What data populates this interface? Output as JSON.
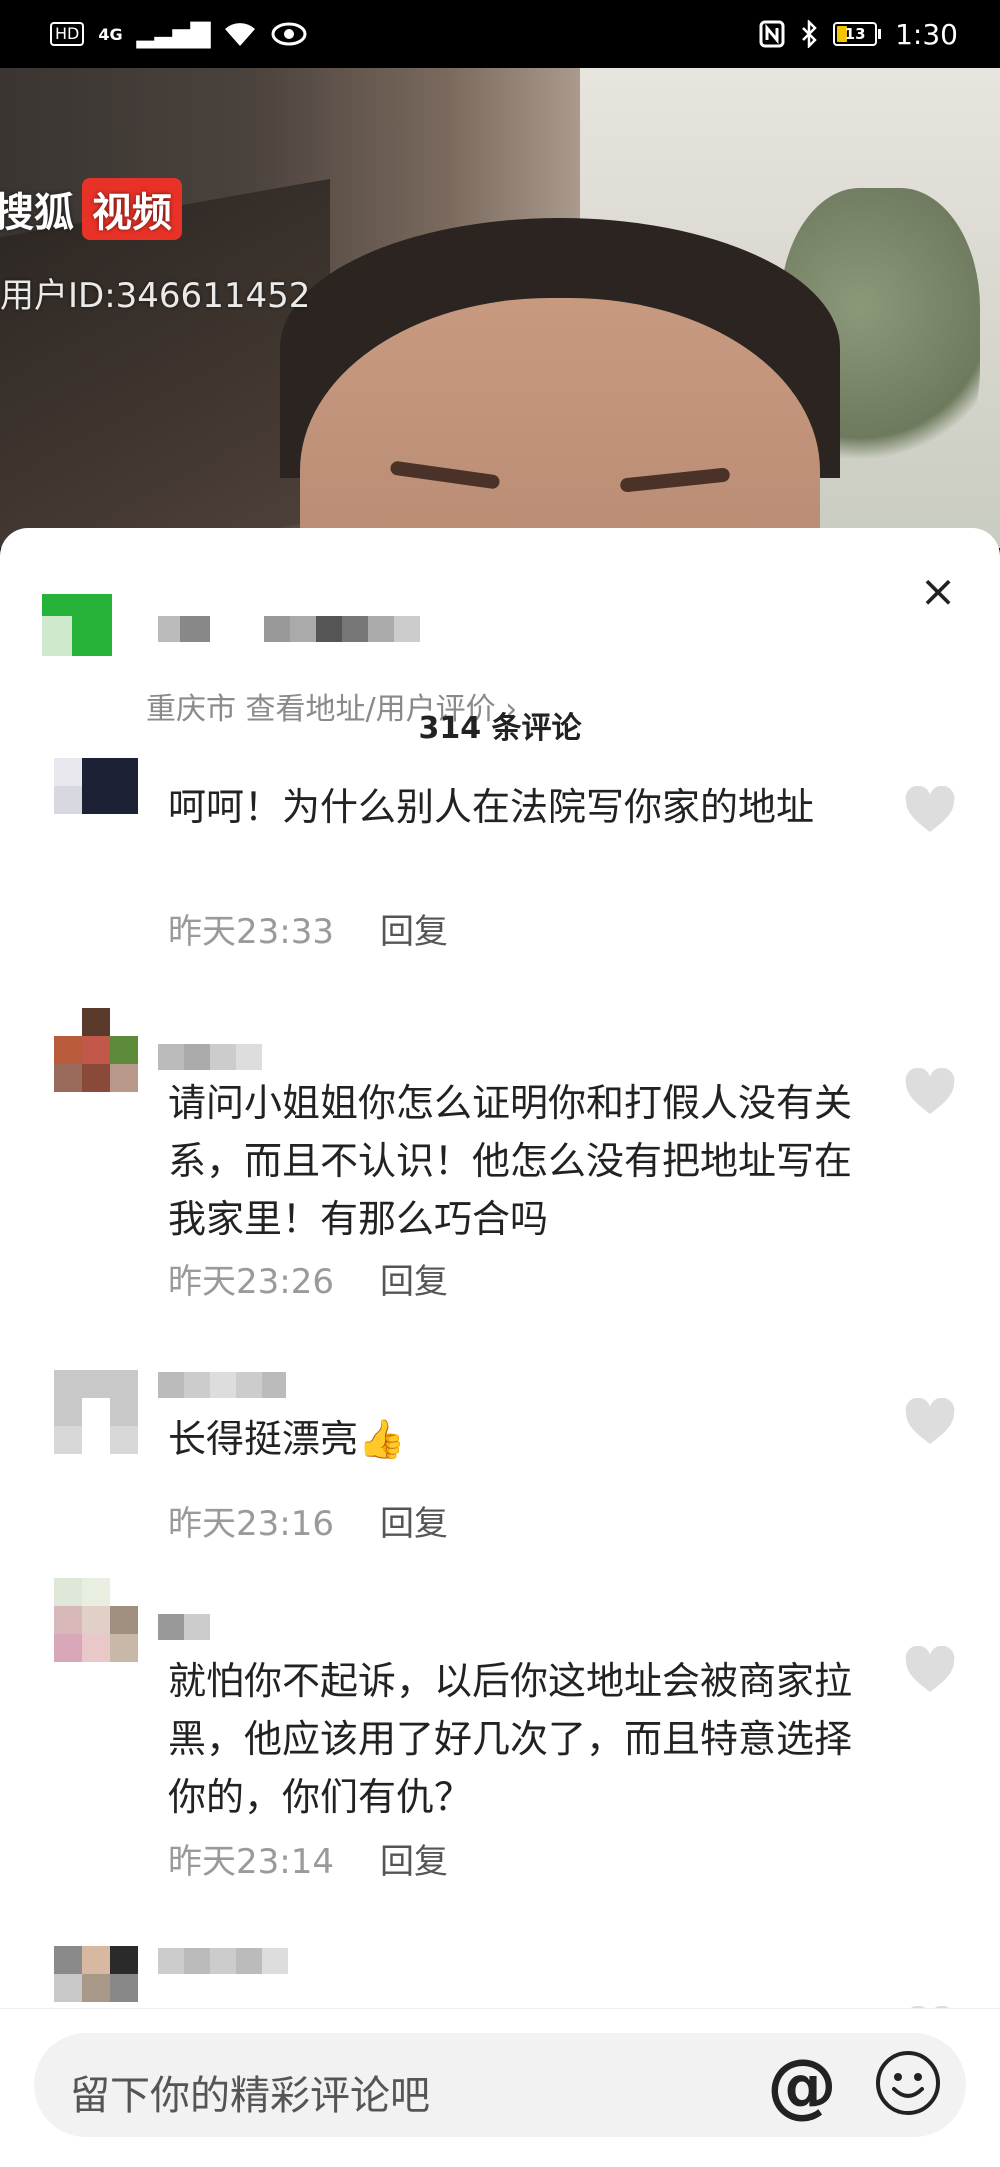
{
  "status_bar": {
    "hd": "HD",
    "network": "4G",
    "battery": "13",
    "time": "1:30"
  },
  "video": {
    "watermark_brand": "搜狐",
    "watermark_video": "视频",
    "watermark_user": "用户ID:346611452"
  },
  "sheet": {
    "shop_subtitle": "重庆市  查看地址/用户评价 ›",
    "close": "×",
    "comment_count": "314 条评论"
  },
  "comments": [
    {
      "text": "呵呵！为什么别人在法院写你家的地址",
      "time": "昨天23:33",
      "reply": "回复"
    },
    {
      "text": "请问小姐姐你怎么证明你和打假人没有关系，而且不认识！他怎么没有把地址写在我家里！有那么巧合吗",
      "time": "昨天23:26",
      "reply": "回复"
    },
    {
      "text": "长得挺漂亮",
      "emoji": "👍",
      "time": "昨天23:16",
      "reply": "回复"
    },
    {
      "text": "就怕你不起诉，以后你这地址会被商家拉黑，他应该用了好几次了，而且特意选择你的，你们有仇？",
      "time": "昨天23:14",
      "reply": "回复"
    }
  ],
  "input": {
    "placeholder": "留下你的精彩评论吧",
    "at": "@"
  },
  "icons": {
    "like": "heart-outline-icon",
    "close": "close-icon",
    "mention": "at-icon",
    "emoji": "emoji-icon"
  }
}
